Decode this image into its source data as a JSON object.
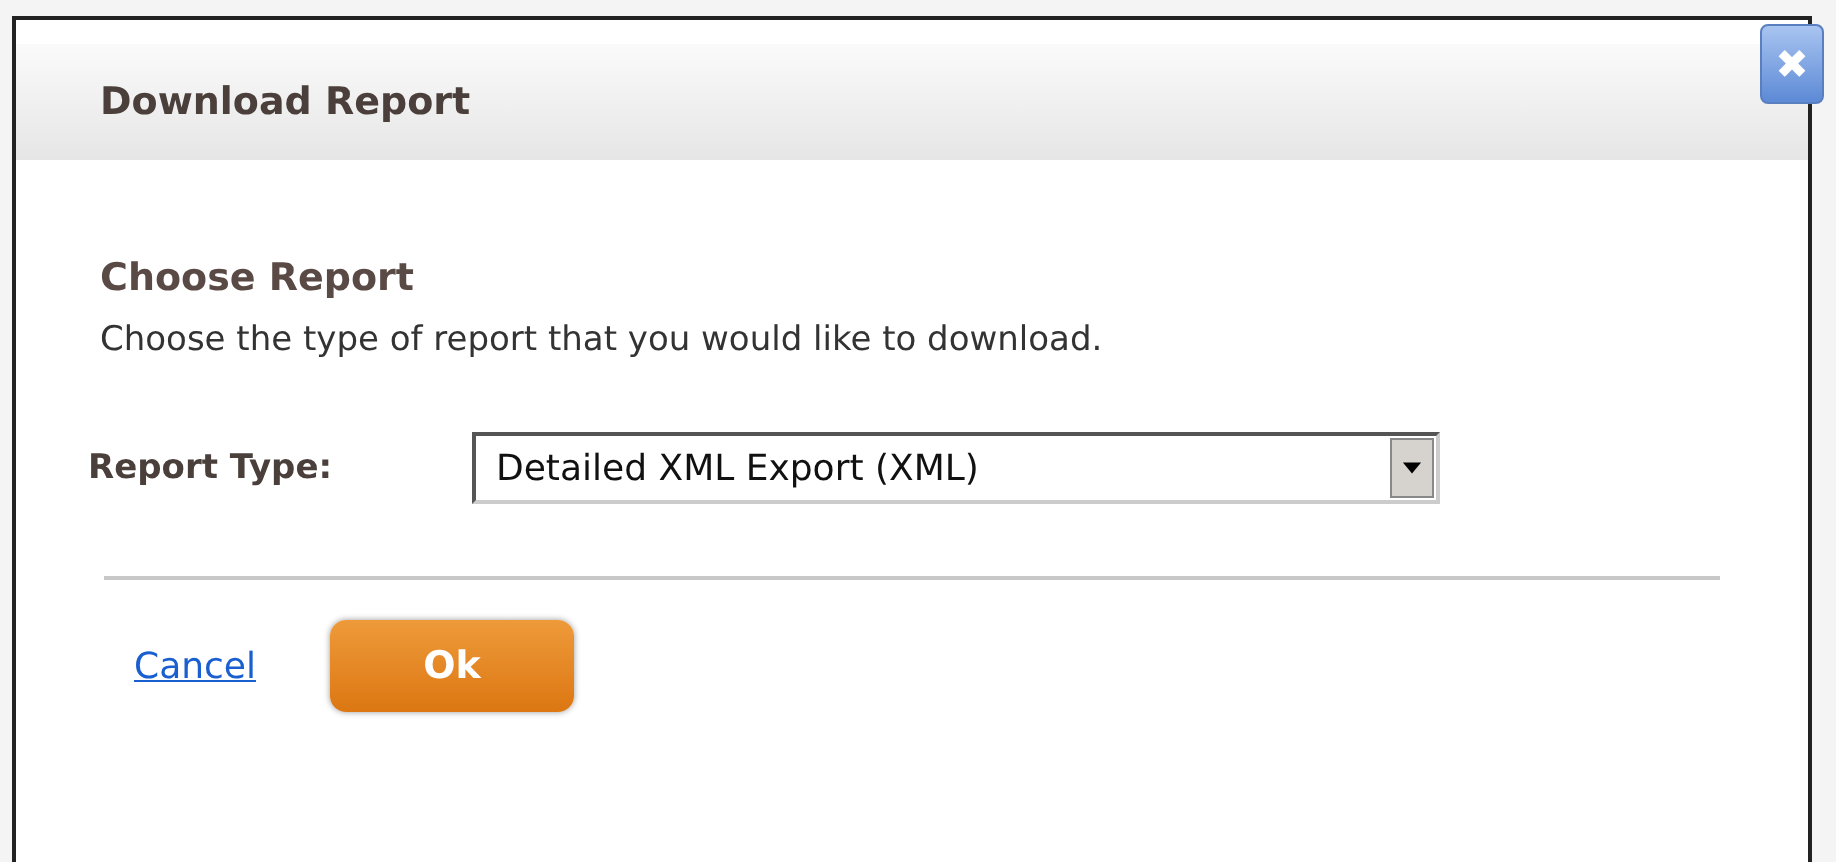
{
  "dialog": {
    "title": "Download Report",
    "close_label": "✖"
  },
  "section": {
    "heading": "Choose Report",
    "description": "Choose the type of report that you would like to download."
  },
  "report_type": {
    "label": "Report Type:",
    "value": "Detailed XML Export (XML)"
  },
  "actions": {
    "cancel": "Cancel",
    "ok": "Ok"
  }
}
